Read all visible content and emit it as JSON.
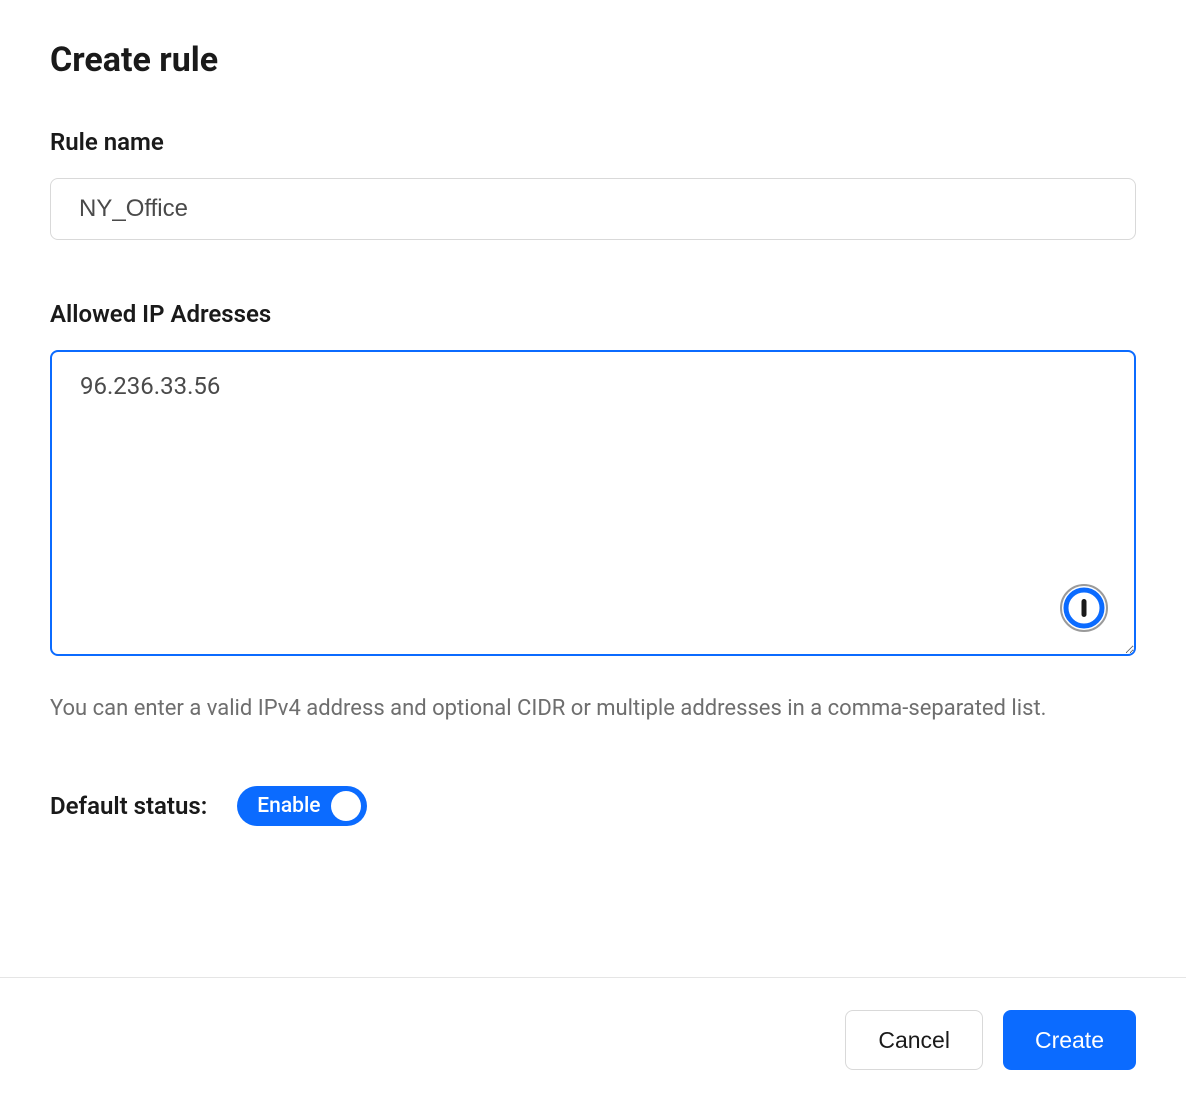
{
  "title": "Create rule",
  "ruleName": {
    "label": "Rule name",
    "value": "NY_Office"
  },
  "allowedIps": {
    "label": "Allowed IP Adresses",
    "value": "96.236.33.56",
    "helper": "You can enter a valid IPv4 address and optional CIDR or multiple addresses in a comma-separated list."
  },
  "defaultStatus": {
    "label": "Default status:",
    "toggleLabel": "Enable",
    "enabled": true
  },
  "buttons": {
    "cancel": "Cancel",
    "create": "Create"
  }
}
